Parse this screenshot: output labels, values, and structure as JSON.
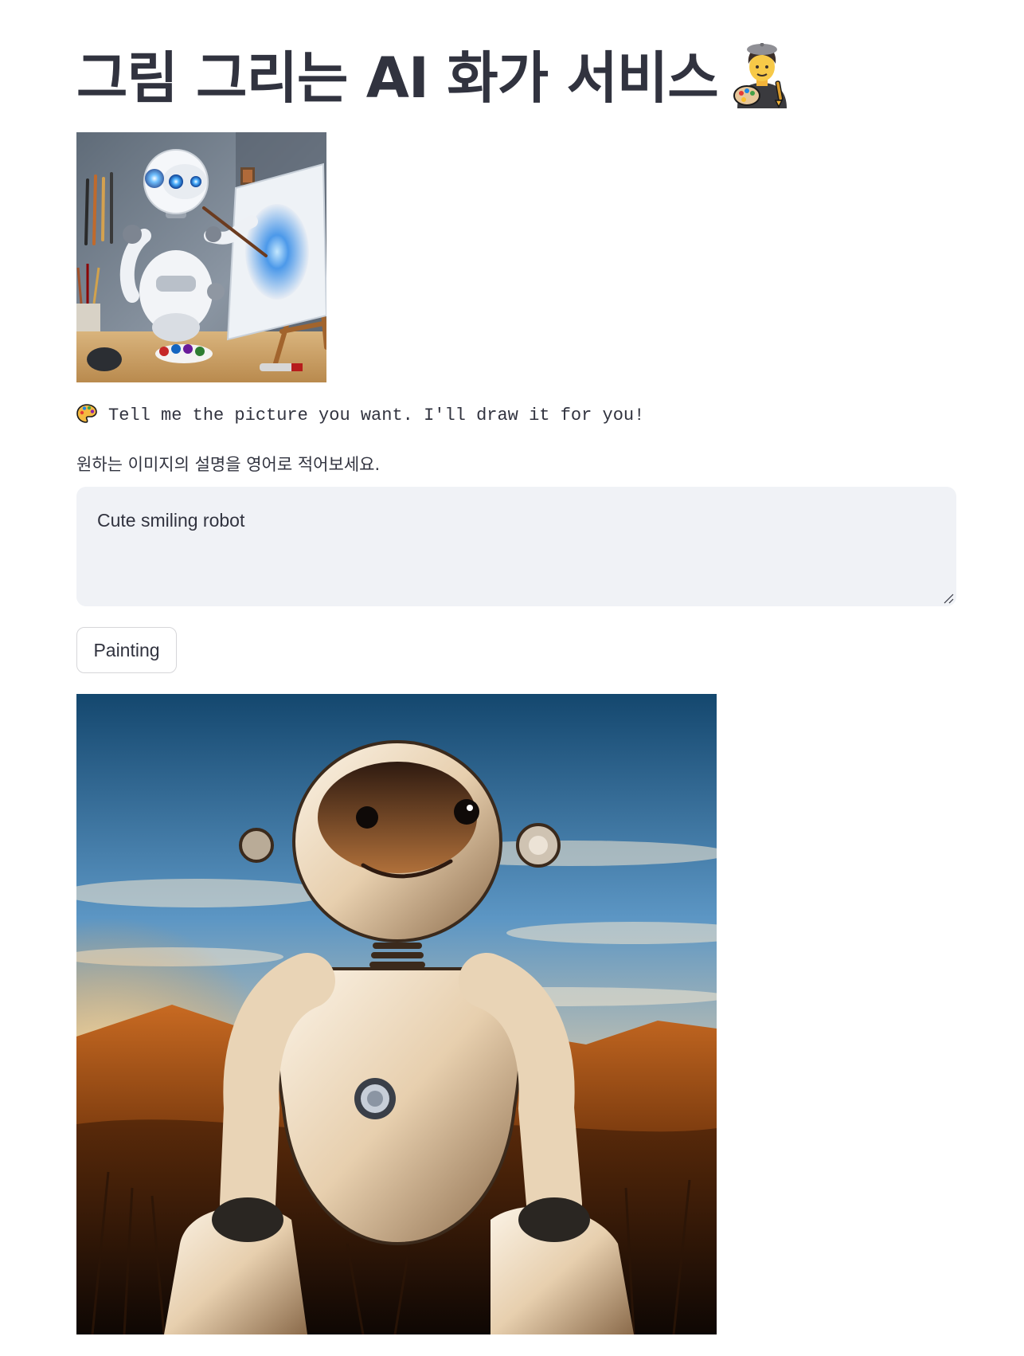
{
  "page": {
    "title": "그림 그리는 AI 화가 서비스",
    "title_emoji": "artist-emoji"
  },
  "hero_image": {
    "alt": "robot painting on canvas"
  },
  "prompt_line": {
    "icon": "palette-icon",
    "text": "Tell me the picture you want. I'll draw it for you!"
  },
  "input": {
    "label": "원하는 이미지의 설명을 영어로 적어보세요.",
    "value": "Cute smiling robot"
  },
  "button": {
    "label": "Painting"
  },
  "result_image": {
    "alt": "cute smiling robot in a sunset landscape"
  },
  "colors": {
    "text": "#31333f",
    "input_bg": "#f0f2f6",
    "button_border": "#d6d6d9"
  }
}
